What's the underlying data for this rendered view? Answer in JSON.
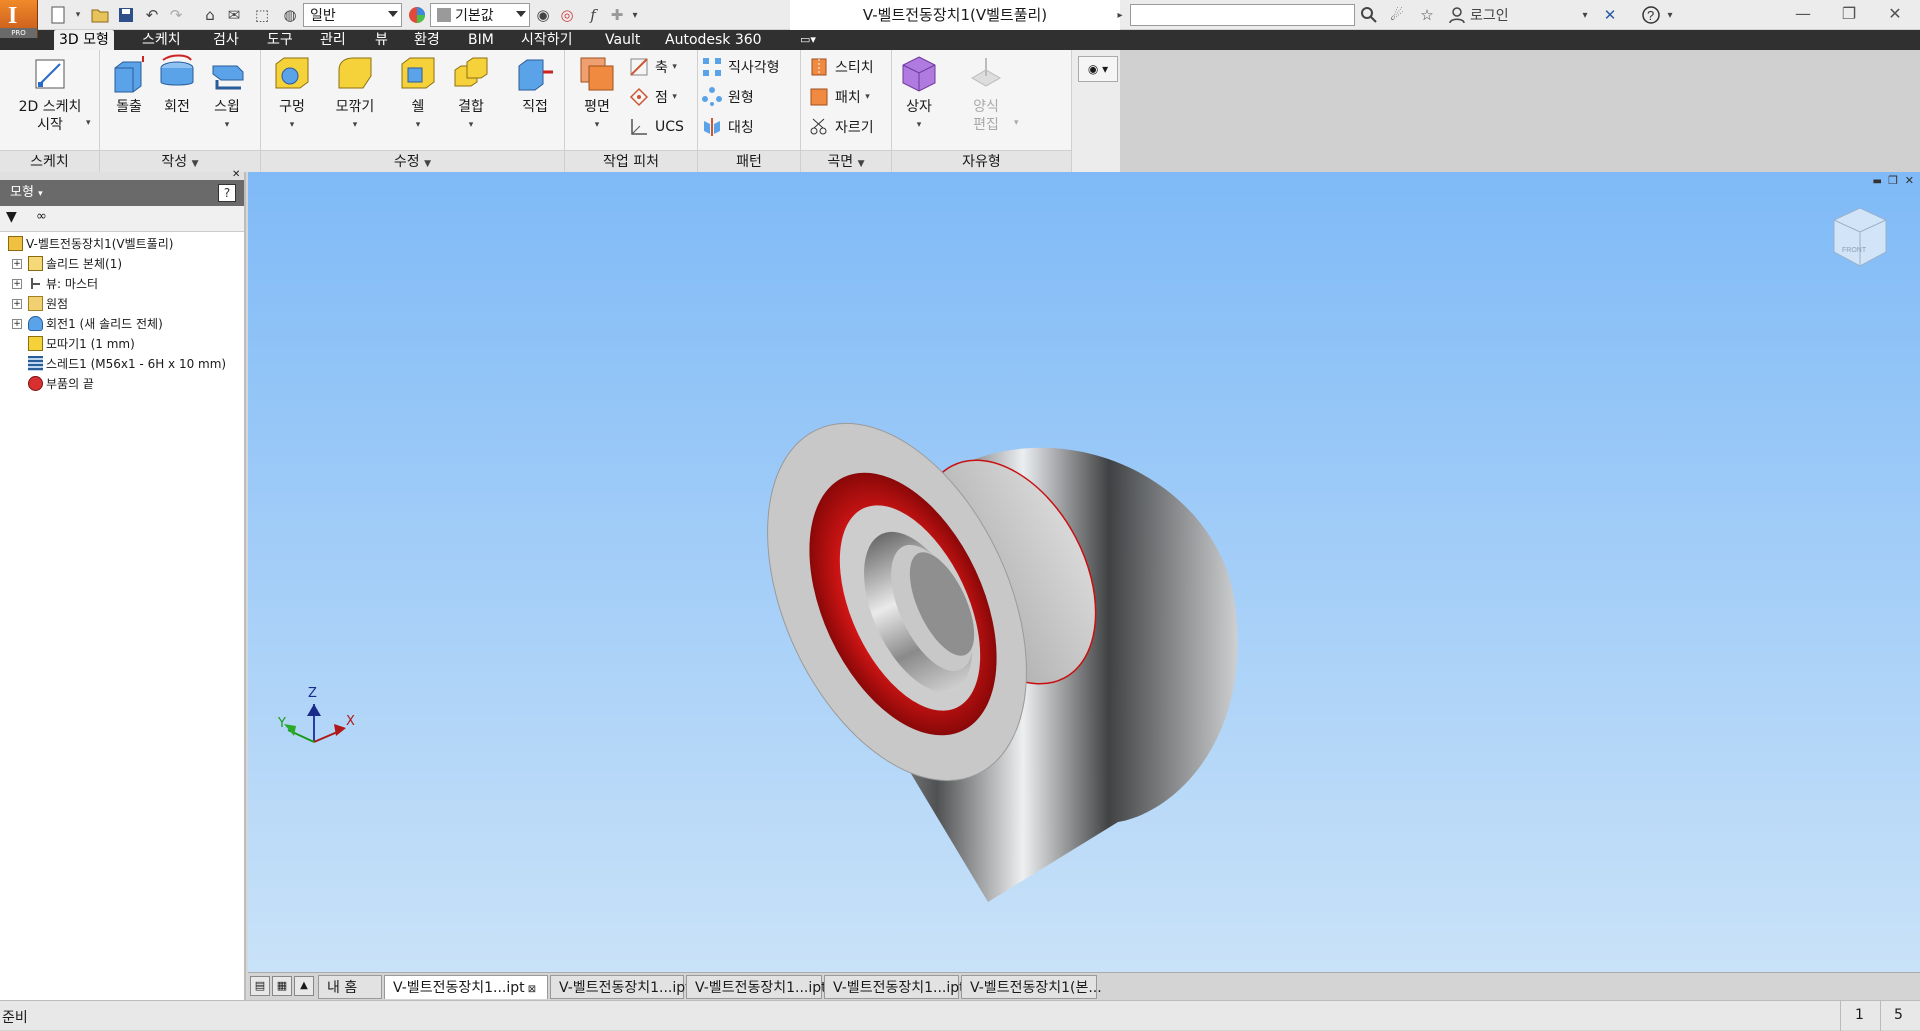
{
  "window": {
    "document_title": "V-벨트전동장치1(V벨트풀리)",
    "app_badge": "PRO",
    "app_initial": "I"
  },
  "quick_access": {
    "style_combo": "일반",
    "appearance_combo": "기본값",
    "fx_label": "f",
    "login_label": "로그인"
  },
  "ribbon_tabs": [
    "3D 모형",
    "스케치",
    "검사",
    "도구",
    "관리",
    "뷰",
    "환경",
    "BIM",
    "시작하기",
    "Vault",
    "Autodesk 360"
  ],
  "active_tab": "3D 모형",
  "ribbon": {
    "sketch": {
      "label": "스케치",
      "start_line1": "2D 스케치",
      "start_line2": "시작"
    },
    "create": {
      "label": "작성",
      "extrude": "돌출",
      "revolve": "회전",
      "sweep": "스윕"
    },
    "modify": {
      "label": "수정",
      "hole": "구멍",
      "fillet": "모깎기",
      "shell": "쉘",
      "combine": "결합",
      "direct": "직접"
    },
    "work": {
      "label": "작업 피처",
      "plane": "평면",
      "axis": "축",
      "point": "점",
      "ucs": "UCS"
    },
    "pattern": {
      "label": "패턴",
      "rect": "직사각형",
      "circ": "원형",
      "mirror": "대칭"
    },
    "surface": {
      "label": "곡면",
      "stitch": "스티치",
      "patch": "패치",
      "trim": "자르기"
    },
    "freeform": {
      "label": "자유형",
      "box": "상자",
      "edit_line1": "양식",
      "edit_line2": "편집"
    }
  },
  "browser": {
    "title": "모형",
    "help": "?",
    "items": [
      {
        "label": "V-벨트전동장치1(V벨트풀리)",
        "indent": 0,
        "exp": false,
        "icon": "part-icon"
      },
      {
        "label": "솔리드 본체(1)",
        "indent": 1,
        "exp": true,
        "icon": "solid-bodies-icon"
      },
      {
        "label": "뷰: 마스터",
        "indent": 1,
        "exp": true,
        "icon": "view-rep-icon"
      },
      {
        "label": "원점",
        "indent": 1,
        "exp": true,
        "icon": "origin-folder-icon"
      },
      {
        "label": "회전1 (새 솔리드 전체)",
        "indent": 1,
        "exp": true,
        "icon": "revolve-feature-icon"
      },
      {
        "label": "모따기1 (1 mm)",
        "indent": 1,
        "exp": false,
        "icon": "chamfer-feature-icon"
      },
      {
        "label": "스레드1 (M56x1 - 6H x 10 mm)",
        "indent": 1,
        "exp": false,
        "icon": "thread-feature-icon"
      },
      {
        "label": "부품의 끝",
        "indent": 1,
        "exp": false,
        "icon": "end-of-part-icon"
      }
    ]
  },
  "viewcube": {
    "face": "FRONT"
  },
  "triad": {
    "x": "X",
    "y": "Y",
    "z": "Z"
  },
  "doc_tabs": [
    {
      "label": "내 홈",
      "active": false
    },
    {
      "label": "V-벨트전동장치1...ipt",
      "active": true
    },
    {
      "label": "V-벨트전동장치1...ipt",
      "active": false
    },
    {
      "label": "V-벨트전동장치1...ipt",
      "active": false
    },
    {
      "label": "V-벨트전동장치1...ipt",
      "active": false
    },
    {
      "label": "V-벨트전동장치1(본...",
      "active": false
    }
  ],
  "status": {
    "text": "준비",
    "count1": "1",
    "count2": "5"
  },
  "colors": {
    "accent": "#f08a2a",
    "tabbar": "#303030",
    "viewport_top": "#7fbaf7",
    "viewport_bottom": "#c9e2f8",
    "thread_red": "#c81010"
  }
}
